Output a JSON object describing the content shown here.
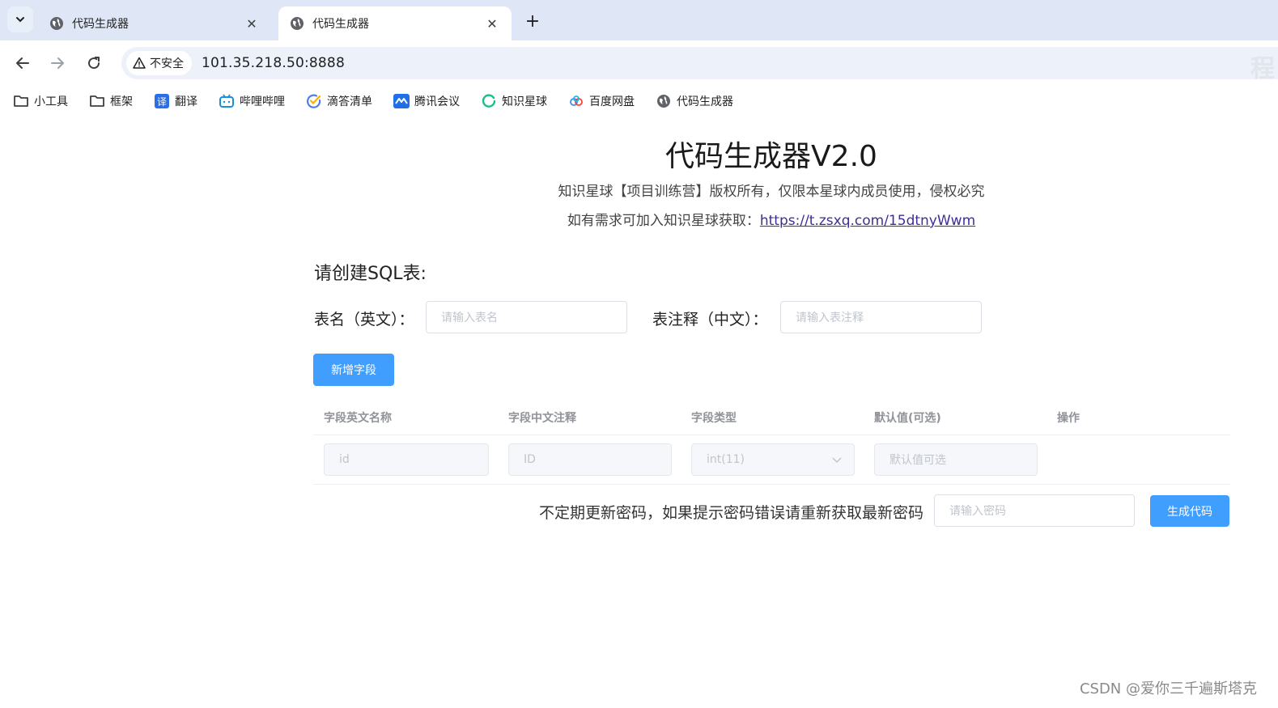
{
  "browser": {
    "tabs": [
      {
        "title": "代码生成器",
        "icon": "globe-icon",
        "active": false
      },
      {
        "title": "代码生成器",
        "icon": "globe-icon",
        "active": true
      }
    ],
    "close_glyph": "✕",
    "new_tab_glyph": "+",
    "security_label": "不安全",
    "url": "101.35.218.50:8888",
    "omnibox_right_glyph": "程",
    "bookmarks": [
      {
        "label": "小工具",
        "icon": "folder-icon"
      },
      {
        "label": "框架",
        "icon": "folder-icon"
      },
      {
        "label": "翻译",
        "icon": "translate-icon"
      },
      {
        "label": "哔哩哔哩",
        "icon": "bilibili-icon"
      },
      {
        "label": "滴答清单",
        "icon": "check-circle-icon"
      },
      {
        "label": "腾讯会议",
        "icon": "meeting-icon"
      },
      {
        "label": "知识星球",
        "icon": "ring-icon"
      },
      {
        "label": "百度网盘",
        "icon": "cloud-icon"
      },
      {
        "label": "代码生成器",
        "icon": "globe-icon"
      }
    ]
  },
  "page": {
    "title": "代码生成器V2.0",
    "copyright": "知识星球【项目训练营】版权所有，仅限本星球内成员使用，侵权必究",
    "info_prefix": "如有需求可加入知识星球获取：",
    "info_link": "https://t.zsxq.com/15dtnyWwm",
    "section_heading": "请创建SQL表:",
    "table_name_label": "表名（英文）：",
    "table_name_placeholder": "请输入表名",
    "table_comment_label": "表注释（中文）：",
    "table_comment_placeholder": "请输入表注释",
    "add_field_button": "新增字段",
    "columns": [
      "字段英文名称",
      "字段中文注释",
      "字段类型",
      "默认值(可选)",
      "操作"
    ],
    "row": {
      "name": "id",
      "comment": "ID",
      "type": "int(11)",
      "default_placeholder": "默认值可选"
    },
    "password_note": "不定期更新密码，如果提示密码错误请重新获取最新密码",
    "password_placeholder": "请输入密码",
    "generate_button": "生成代码"
  },
  "watermark": "CSDN @爱你三千遍斯塔克",
  "colors": {
    "primary": "#409eff",
    "tabstrip": "#dfe7f7",
    "omnibox": "#edf1fa",
    "link": "#3b2f9a"
  }
}
